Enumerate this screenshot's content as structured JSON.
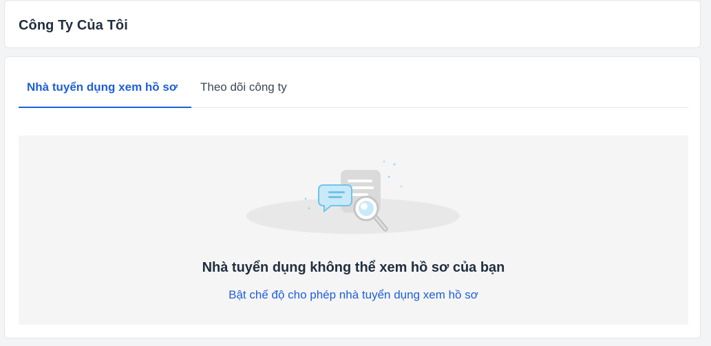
{
  "header": {
    "title": "Công Ty Của Tôi"
  },
  "tabs": [
    {
      "label": "Nhà tuyển dụng xem hồ sơ",
      "active": true
    },
    {
      "label": "Theo dõi công ty",
      "active": false
    }
  ],
  "empty_state": {
    "icon": "search-empty-illustration",
    "title": "Nhà tuyển dụng không thể xem hồ sơ của bạn",
    "action_link": "Bật chế độ cho phép nhà tuyển dụng xem hồ sơ"
  },
  "colors": {
    "accent": "#1d5fd8",
    "text": "#212f3f",
    "panel_bg": "#f5f5f5"
  }
}
